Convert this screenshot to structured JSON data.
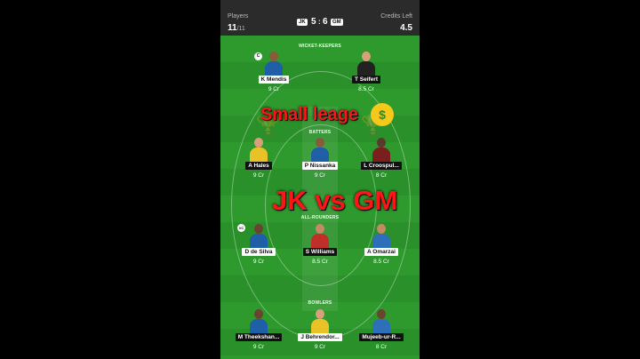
{
  "header": {
    "players_label": "Players",
    "players_count": "11",
    "players_total": "/11",
    "team1": "JK",
    "team1_score": "5",
    "score_sep": ":",
    "team2_score": "6",
    "team2": "GM",
    "credits_label": "Credits Left",
    "credits_value": "4.5"
  },
  "sections": {
    "wk": "WICKET-KEEPERS",
    "bat": "BATTERS",
    "ar": "ALL-ROUNDERS",
    "bowl": "BOWLERS"
  },
  "players": {
    "wk": [
      {
        "name": "K Mendis",
        "credits": "9 Cr",
        "badge": "C"
      },
      {
        "name": "T Seifert",
        "credits": "8.5 Cr"
      }
    ],
    "bat": [
      {
        "name": "A Hales",
        "credits": "9 Cr"
      },
      {
        "name": "P Nissanka",
        "credits": "9 Cr"
      },
      {
        "name": "L Croospul...",
        "credits": "8 Cr"
      }
    ],
    "ar": [
      {
        "name": "D de Silva",
        "credits": "9 Cr",
        "badge": "VC"
      },
      {
        "name": "S Williams",
        "credits": "8.5 Cr"
      },
      {
        "name": "A Omarzai",
        "credits": "8.5 Cr"
      }
    ],
    "bowl": [
      {
        "name": "M Theekshan...",
        "credits": "9 Cr"
      },
      {
        "name": "J Behrendor...",
        "credits": "9 Cr"
      },
      {
        "name": "Mujeeb-ur-R...",
        "credits": "8 Cr"
      }
    ]
  },
  "overlay": {
    "line1": "Small leage",
    "emoji": "money-mouth-face",
    "line2": "JK vs GM"
  },
  "colors": {
    "field": "#2e9a2e",
    "header": "#2b2b2b",
    "overlay_text": "#ff1515",
    "jersey_jk": "#1e5fa8",
    "jersey_gm": "#222222"
  }
}
